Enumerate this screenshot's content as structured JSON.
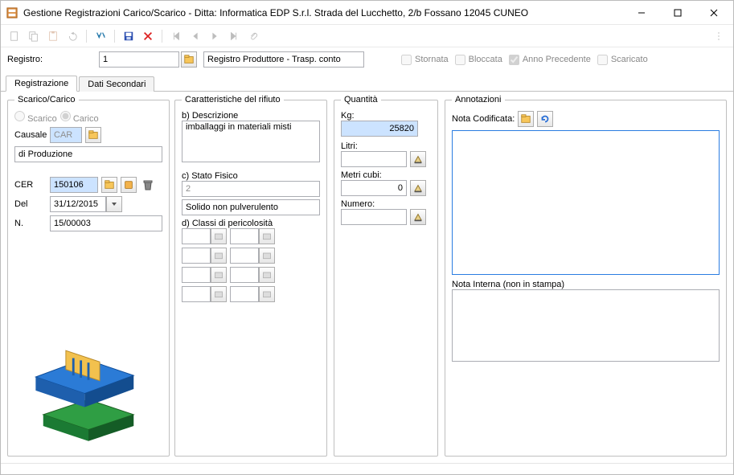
{
  "window": {
    "title": "Gestione Registrazioni Carico/Scarico - Ditta: Informatica EDP S.r.l. Strada del Lucchetto, 2/b Fossano 12045 CUNEO"
  },
  "registro": {
    "label": "Registro:",
    "value": "1",
    "desc": "Registro Produttore - Trasp. conto",
    "flags": {
      "stornata": "Stornata",
      "bloccata": "Bloccata",
      "anno_precedente": "Anno Precedente",
      "scaricato": "Scaricato"
    }
  },
  "tabs": {
    "registrazione": "Registrazione",
    "dati_secondari": "Dati Secondari"
  },
  "scarico_carico": {
    "legend": "Scarico/Carico",
    "scarico": "Scarico",
    "carico": "Carico",
    "causale_label": "Causale",
    "causale_value": "CAR",
    "causale_desc": "di Produzione",
    "cer_label": "CER",
    "cer_value": "150106",
    "del_label": "Del",
    "del_value": "31/12/2015",
    "n_label": "N.",
    "n_value": "15/00003"
  },
  "caratt": {
    "legend": "Caratteristiche del rifiuto",
    "b_label": "b) Descrizione",
    "b_value": "imballaggi in materiali misti",
    "c_label": "c) Stato Fisico",
    "c_code": "2",
    "c_desc": "Solido non pulverulento",
    "d_label": "d) Classi di pericolosità"
  },
  "quantita": {
    "legend": "Quantità",
    "kg_label": "Kg:",
    "kg_value": "25820",
    "litri_label": "Litri:",
    "litri_value": "",
    "mc_label": "Metri cubi:",
    "mc_value": "0",
    "numero_label": "Numero:",
    "numero_value": ""
  },
  "annot": {
    "legend": "Annotazioni",
    "nota_cod_label": "Nota Codificata:",
    "nota_cod_value": "",
    "nota_interna_label": "Nota Interna (non in stampa)",
    "nota_interna_value": ""
  }
}
